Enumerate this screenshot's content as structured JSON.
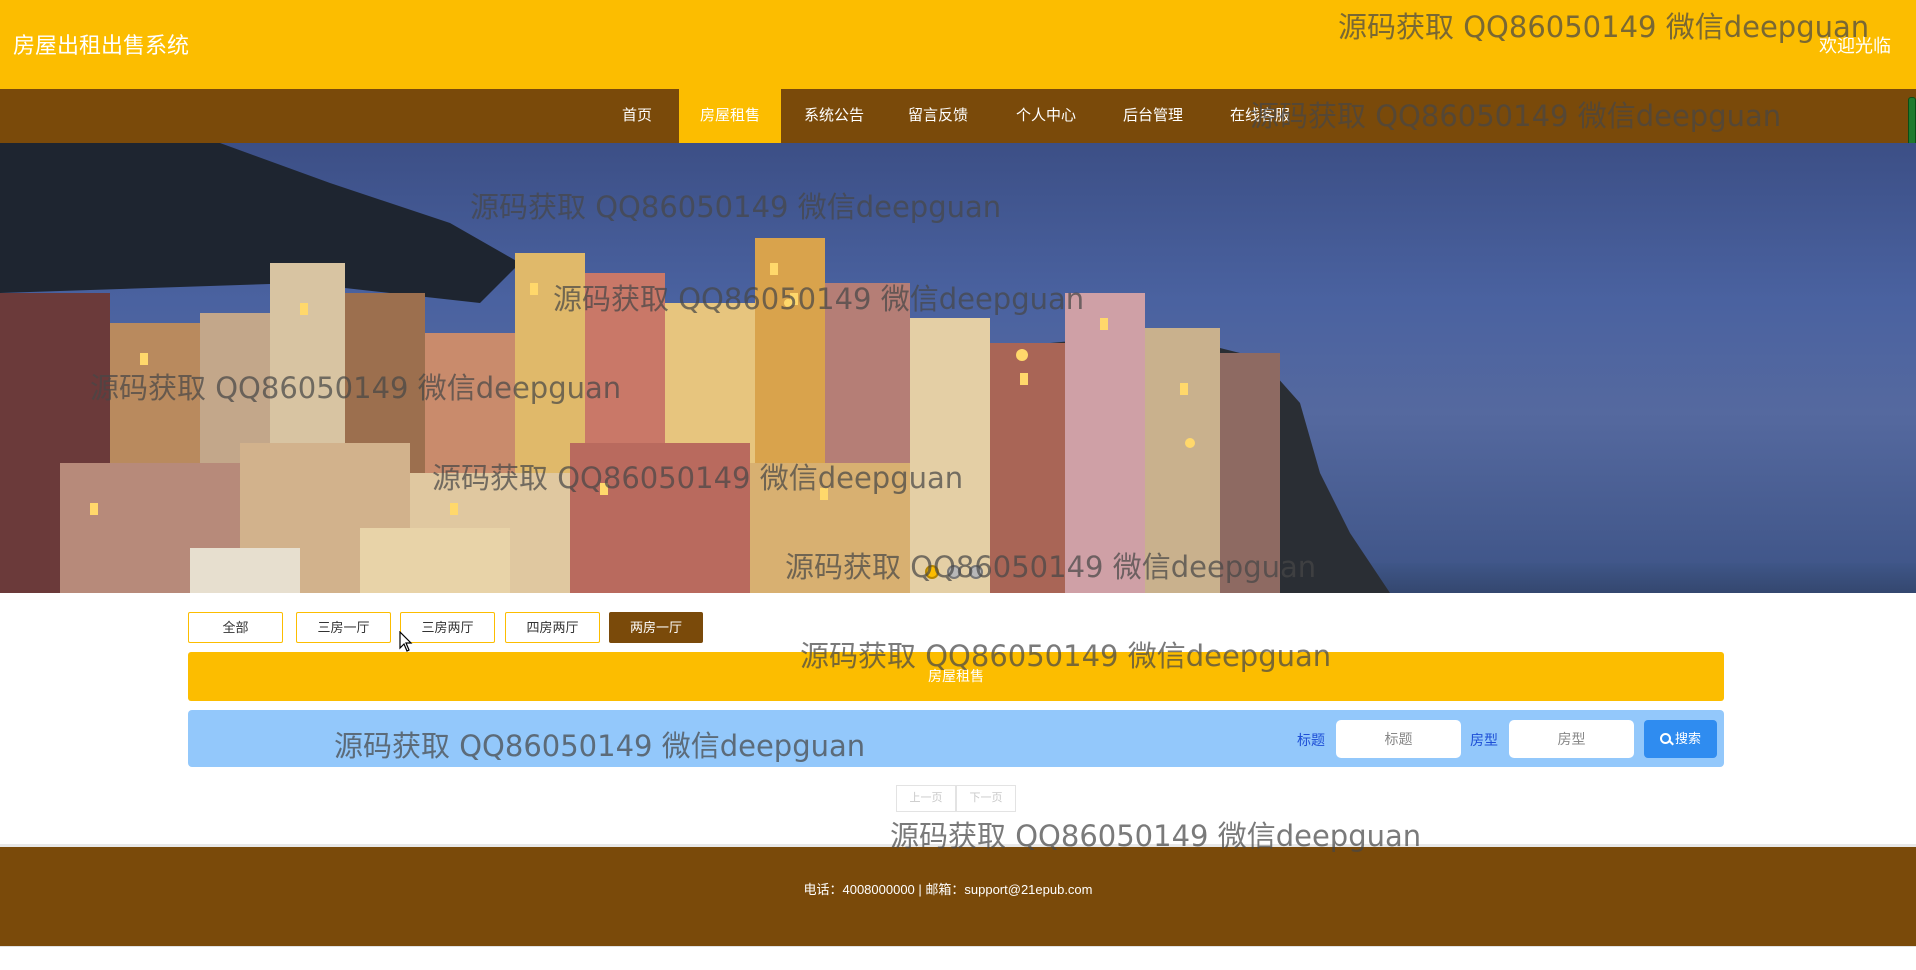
{
  "header": {
    "app_title": "房屋出租出售系统",
    "welcome": "欢迎光临"
  },
  "nav": {
    "items": [
      {
        "label": "首页",
        "active": false
      },
      {
        "label": "房屋租售",
        "active": true
      },
      {
        "label": "系统公告",
        "active": false
      },
      {
        "label": "留言反馈",
        "active": false
      },
      {
        "label": "个人中心",
        "active": false
      },
      {
        "label": "后台管理",
        "active": false
      },
      {
        "label": "在线客服",
        "active": false
      }
    ]
  },
  "banner": {
    "slides": 3,
    "active_slide": 1
  },
  "filters": {
    "items": [
      {
        "label": "全部",
        "active": false
      },
      {
        "label": "三房一厅",
        "active": false
      },
      {
        "label": "三房两厅",
        "active": false
      },
      {
        "label": "四房两厅",
        "active": false
      },
      {
        "label": "两房一厅",
        "active": true
      }
    ]
  },
  "section": {
    "title": "房屋租售"
  },
  "search": {
    "title_label": "标题",
    "title_placeholder": "标题",
    "type_label": "房型",
    "type_placeholder": "房型",
    "button_label": "搜索"
  },
  "pagination": {
    "prev": "上一页",
    "next": "下一页"
  },
  "footer": {
    "text": "电话：4008000000 | 邮箱：support@21epub.com"
  },
  "watermark": {
    "text": "源码获取 QQ86050149 微信deepguan"
  },
  "colors": {
    "header": "#fcbd00",
    "nav": "#7a4a0a",
    "search_bar": "#93c8fb",
    "search_button": "#2f8cf0"
  }
}
